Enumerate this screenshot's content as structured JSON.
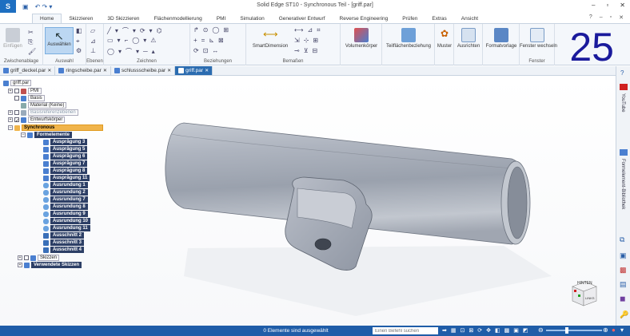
{
  "app": {
    "title": "Solid Edge ST10 - Synchronous Teil - [griff.par]",
    "qa_undo": "↶ ↷ ▾",
    "qa_save": "▣"
  },
  "ribbon_tabs": [
    "Home",
    "Skizzieren",
    "3D Skizzieren",
    "Flächenmodellierung",
    "PMI",
    "Simulation",
    "Generativer Entwurf",
    "Reverse Engineering",
    "Prüfen",
    "Extras",
    "Ansicht"
  ],
  "active_tab": "Home",
  "ribbon": {
    "paste": "Einfügen",
    "clipboard": "Zwischenablage",
    "select": "Auswählen",
    "select_group": "Auswahl",
    "planes": "Ebenen",
    "draw": "Zeichnen",
    "relations": "Beziehungen",
    "smartdim": "SmartDimension",
    "dims": "Bemaßen",
    "solid": "Volumenkörper",
    "face_rel": "Teilflächenbeziehung",
    "pattern": "Muster",
    "views": "Ausrichten",
    "style": "Formatvorlage",
    "switch_window": "Fenster wechseln",
    "window": "Fenster"
  },
  "overlay_number": "25",
  "doc_tabs": [
    {
      "label": "griff_deckel.par",
      "active": false
    },
    {
      "label": "ringscheibe.par",
      "active": false
    },
    {
      "label": "schlussscheibe.par",
      "active": false
    },
    {
      "label": "griff.par",
      "active": true
    }
  ],
  "tree": {
    "root": "griff.par",
    "pmi": "PMI",
    "base": "Basis",
    "material": "Material (Keine)",
    "refplanes": "Basisreferenzebenen",
    "design_body": "Entwurfskörper",
    "sync": "Synchronous",
    "features": "Formelemente",
    "items": [
      "Ausprägung 3",
      "Ausprägung 5",
      "Ausprägung 6",
      "Ausprägung 7",
      "Ausprägung 8",
      "Ausprägung 11",
      "Ausrundung 1",
      "Ausrundung 2",
      "Ausrundung 7",
      "Ausrundung 8",
      "Ausrundung 9",
      "Ausrundung 10",
      "Ausrundung 11",
      "Ausschnitt 2",
      "Ausschnitt 3",
      "Ausschnitt 4"
    ],
    "sketches": "Skizzen",
    "used_sketches": "Verwendete Skizzen"
  },
  "right_panel": {
    "youtube": "YouTube",
    "library": "Formelement-Bibliothek"
  },
  "viewcube": {
    "top": "HINTEN",
    "side": "LINKS"
  },
  "status": {
    "message": "0 Elemente sind ausgewählt",
    "search_placeholder": "Einen Befehl suchen"
  }
}
